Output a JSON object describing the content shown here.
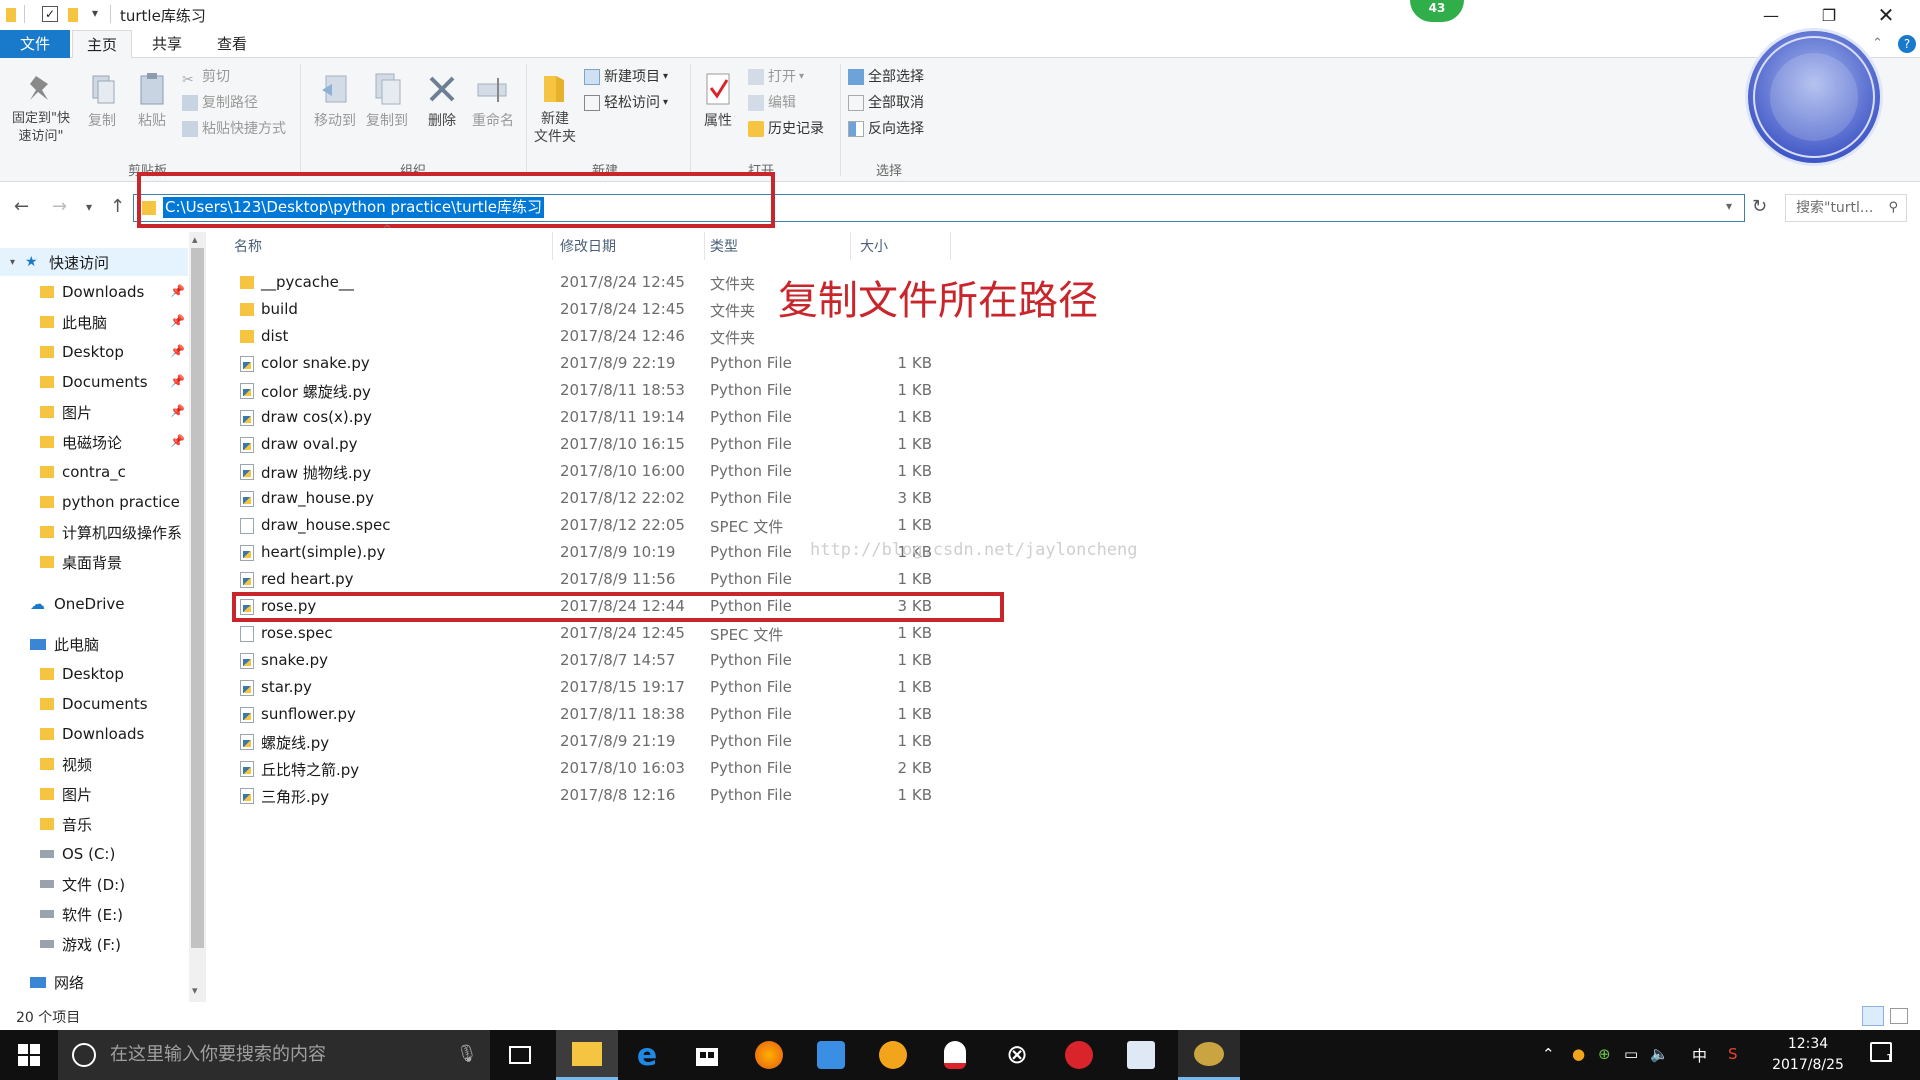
{
  "window": {
    "title": "turtle库练习"
  },
  "ribbon_tabs": [
    "文件",
    "主页",
    "共享",
    "查看"
  ],
  "ribbon": {
    "pin_label": "固定到\"快速访问\"",
    "copy_label": "复制",
    "paste_label": "粘贴",
    "cut_label": "剪切",
    "copy_path_label": "复制路径",
    "paste_shortcut_label": "粘贴快捷方式",
    "move_to_label": "移动到",
    "copy_to_label": "复制到",
    "delete_label": "删除",
    "rename_label": "重命名",
    "new_folder_label": "新建\n文件夹",
    "new_item_label": "新建项目",
    "easy_access_label": "轻松访问",
    "properties_label": "属性",
    "open_label": "打开",
    "edit_label": "编辑",
    "history_label": "历史记录",
    "select_all_label": "全部选择",
    "select_none_label": "全部取消",
    "invert_selection_label": "反向选择",
    "group_clipboard": "剪贴板",
    "group_organize": "组织",
    "group_new": "新建",
    "group_open": "打开",
    "group_select": "选择"
  },
  "address": {
    "path": "C:\\Users\\123\\Desktop\\python practice\\turtle库练习",
    "search_placeholder": "搜索\"turtl...",
    "refresh_icon": "refresh-icon"
  },
  "nav": {
    "quick_access": "快速访问",
    "quick_items": [
      {
        "label": "Downloads",
        "pinned": true
      },
      {
        "label": "此电脑",
        "pinned": true
      },
      {
        "label": "Desktop",
        "pinned": true
      },
      {
        "label": "Documents",
        "pinned": true
      },
      {
        "label": "图片",
        "pinned": true
      },
      {
        "label": "电磁场论",
        "pinned": true
      },
      {
        "label": "contra_c",
        "pinned": false
      },
      {
        "label": "python practice",
        "pinned": false
      },
      {
        "label": "计算机四级操作系",
        "pinned": false
      },
      {
        "label": "桌面背景",
        "pinned": false
      }
    ],
    "onedrive": "OneDrive",
    "this_pc": "此电脑",
    "pc_items": [
      "Desktop",
      "Documents",
      "Downloads",
      "视频",
      "图片",
      "音乐",
      "OS (C:)",
      "文件 (D:)",
      "软件 (E:)",
      "游戏 (F:)"
    ],
    "network": "网络"
  },
  "columns": {
    "name": "名称",
    "modified": "修改日期",
    "type": "类型",
    "size": "大小"
  },
  "files": [
    {
      "name": "__pycache__",
      "date": "2017/8/24 12:45",
      "type": "文件夹",
      "size": "",
      "kind": "folder"
    },
    {
      "name": "build",
      "date": "2017/8/24 12:45",
      "type": "文件夹",
      "size": "",
      "kind": "folder"
    },
    {
      "name": "dist",
      "date": "2017/8/24 12:46",
      "type": "文件夹",
      "size": "",
      "kind": "folder"
    },
    {
      "name": "color snake.py",
      "date": "2017/8/9 22:19",
      "type": "Python File",
      "size": "1 KB",
      "kind": "py"
    },
    {
      "name": "color 螺旋线.py",
      "date": "2017/8/11 18:53",
      "type": "Python File",
      "size": "1 KB",
      "kind": "py"
    },
    {
      "name": "draw cos(x).py",
      "date": "2017/8/11 19:14",
      "type": "Python File",
      "size": "1 KB",
      "kind": "py"
    },
    {
      "name": "draw oval.py",
      "date": "2017/8/10 16:15",
      "type": "Python File",
      "size": "1 KB",
      "kind": "py"
    },
    {
      "name": "draw 抛物线.py",
      "date": "2017/8/10 16:00",
      "type": "Python File",
      "size": "1 KB",
      "kind": "py"
    },
    {
      "name": "draw_house.py",
      "date": "2017/8/12 22:02",
      "type": "Python File",
      "size": "3 KB",
      "kind": "py"
    },
    {
      "name": "draw_house.spec",
      "date": "2017/8/12 22:05",
      "type": "SPEC 文件",
      "size": "1 KB",
      "kind": "spec"
    },
    {
      "name": "heart(simple).py",
      "date": "2017/8/9 10:19",
      "type": "Python File",
      "size": "1 KB",
      "kind": "py"
    },
    {
      "name": "red heart.py",
      "date": "2017/8/9 11:56",
      "type": "Python File",
      "size": "1 KB",
      "kind": "py"
    },
    {
      "name": "rose.py",
      "date": "2017/8/24 12:44",
      "type": "Python File",
      "size": "3 KB",
      "kind": "py"
    },
    {
      "name": "rose.spec",
      "date": "2017/8/24 12:45",
      "type": "SPEC 文件",
      "size": "1 KB",
      "kind": "spec"
    },
    {
      "name": "snake.py",
      "date": "2017/8/7 14:57",
      "type": "Python File",
      "size": "1 KB",
      "kind": "py"
    },
    {
      "name": "star.py",
      "date": "2017/8/15 19:17",
      "type": "Python File",
      "size": "1 KB",
      "kind": "py"
    },
    {
      "name": "sunflower.py",
      "date": "2017/8/11 18:38",
      "type": "Python File",
      "size": "1 KB",
      "kind": "py"
    },
    {
      "name": "螺旋线.py",
      "date": "2017/8/9 21:19",
      "type": "Python File",
      "size": "1 KB",
      "kind": "py"
    },
    {
      "name": "丘比特之箭.py",
      "date": "2017/8/10 16:03",
      "type": "Python File",
      "size": "2 KB",
      "kind": "py"
    },
    {
      "name": "三角形.py",
      "date": "2017/8/8 12:16",
      "type": "Python File",
      "size": "1 KB",
      "kind": "py"
    }
  ],
  "annotation": "复制文件所在路径",
  "watermark": "http://blog.csdn.net/jayloncheng",
  "status": {
    "item_count": "20 个项目"
  },
  "badge": "43",
  "taskbar": {
    "search_placeholder": "在这里输入你要搜索的内容",
    "time": "12:34",
    "date": "2017/8/25",
    "ime": "中",
    "notification_count": "1"
  },
  "colors": {
    "accent": "#1979ca",
    "selection": "#0078d7",
    "annotation_red": "#c9262b",
    "folder": "#f5c542"
  }
}
